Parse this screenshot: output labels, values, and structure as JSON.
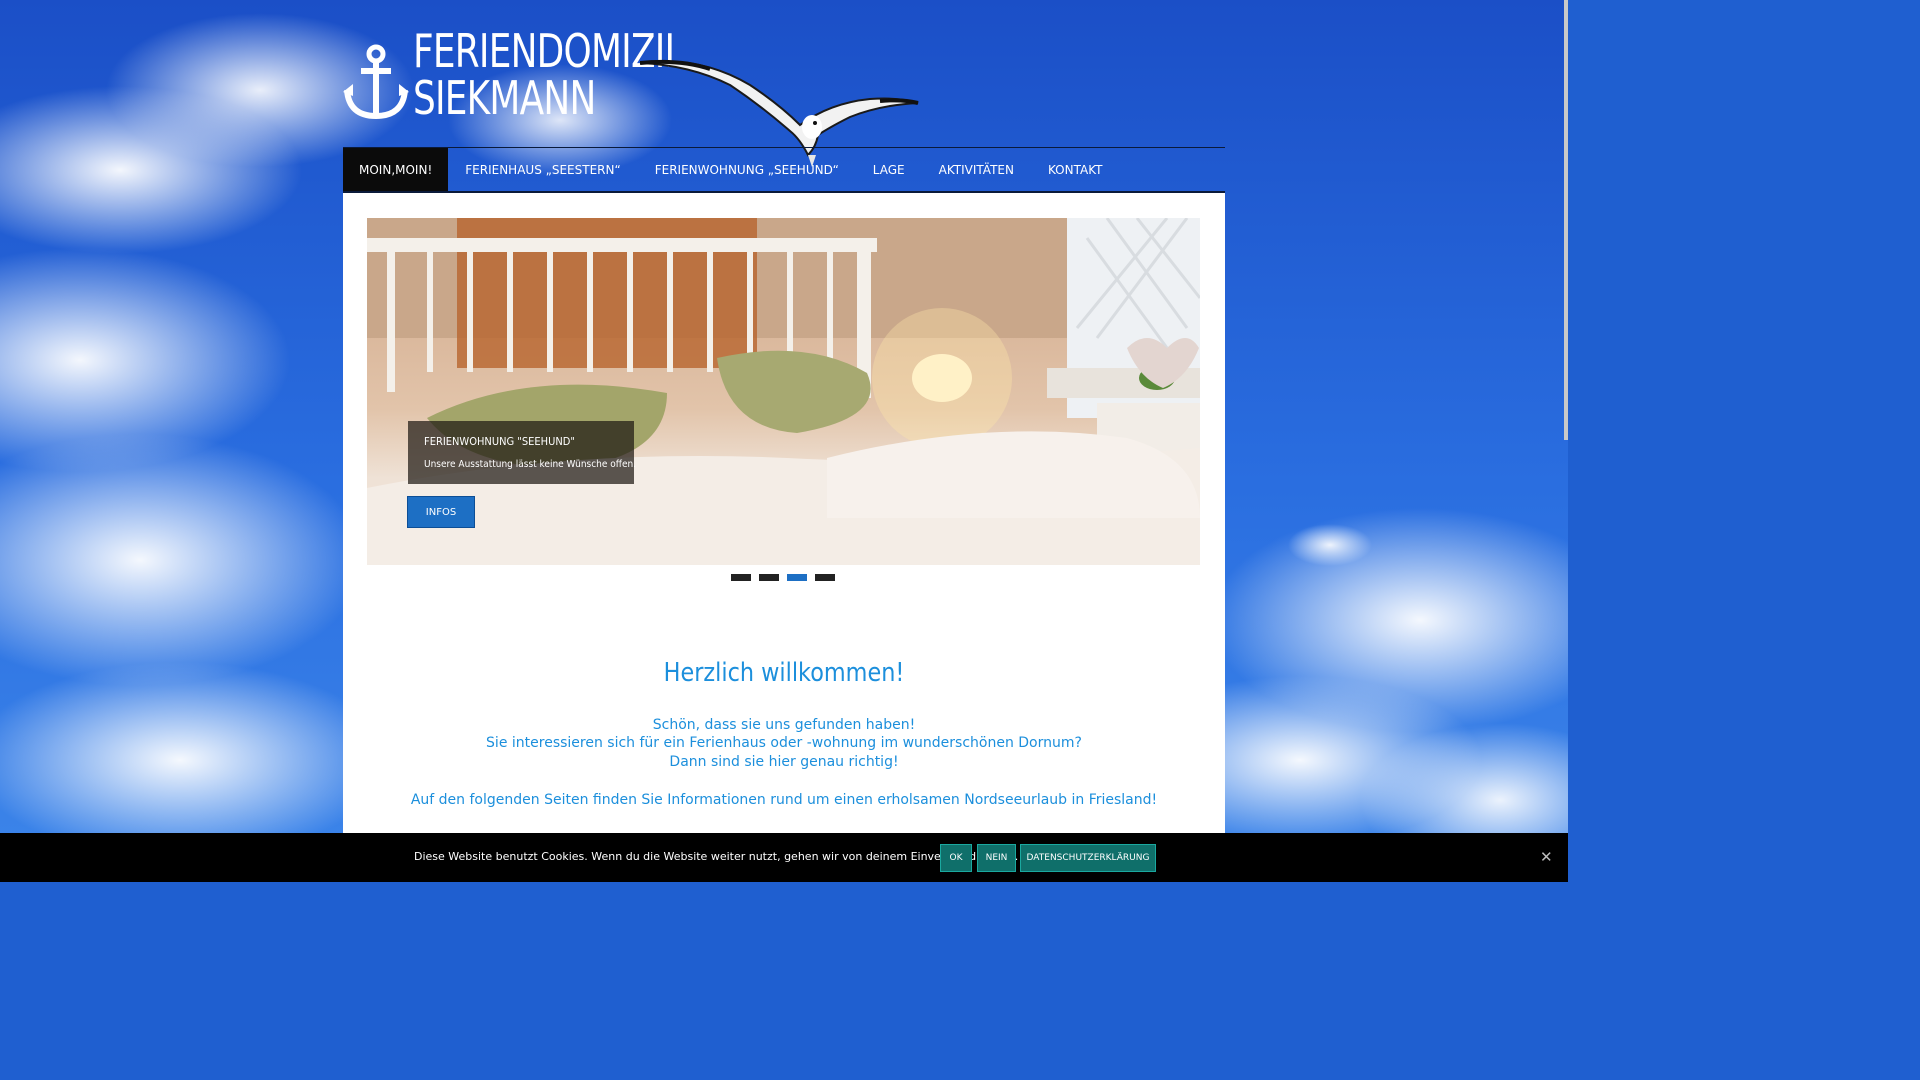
{
  "site": {
    "title_line1": "FERIENDOMIZIL",
    "title_line2": "SIEKMANN"
  },
  "nav": {
    "items": [
      {
        "label": "MOIN,MOIN!"
      },
      {
        "label": "FERIENHAUS „SEESTERN“"
      },
      {
        "label": "FERIENWOHNUNG „SEEHUND“"
      },
      {
        "label": "LAGE"
      },
      {
        "label": "AKTIVITÄTEN"
      },
      {
        "label": "KONTAKT"
      }
    ],
    "active_index": 0
  },
  "slider": {
    "caption_title": "FERIENWOHNUNG \"SEEHUND\"",
    "caption_text": "Unsere Ausstattung lässt keine Wünsche offen.",
    "button_label": "INFOS",
    "slide_count": 4,
    "active_slide": 3
  },
  "welcome": {
    "heading": "Herzlich willkommen!",
    "line1": "Schön, dass sie uns gefunden haben!",
    "line2": "Sie interessieren sich für ein Ferienhaus oder -wohnung im wunderschönen Dornum?",
    "line3": "Dann sind sie hier genau richtig!",
    "line4": "Auf den folgenden Seiten finden Sie Informationen rund um einen erholsamen Nordseeurlaub in Friesland!"
  },
  "cookie": {
    "text": "Diese Website benutzt Cookies. Wenn du die Website weiter nutzt, gehen wir von deinem Einverständnis aus.",
    "ok_label": "OK",
    "no_label": "NEIN",
    "privacy_label": "DATENSCHUTZERKLÄRUNG"
  },
  "colors": {
    "accent_blue": "#1c8fdc",
    "button_blue": "#1d6fc4",
    "cookie_button": "#0f6f6a",
    "nav_active": "#0b0b0b"
  },
  "icons": {
    "logo": "anchor-icon",
    "bird": "seagull-illustration",
    "close": "close-icon"
  }
}
